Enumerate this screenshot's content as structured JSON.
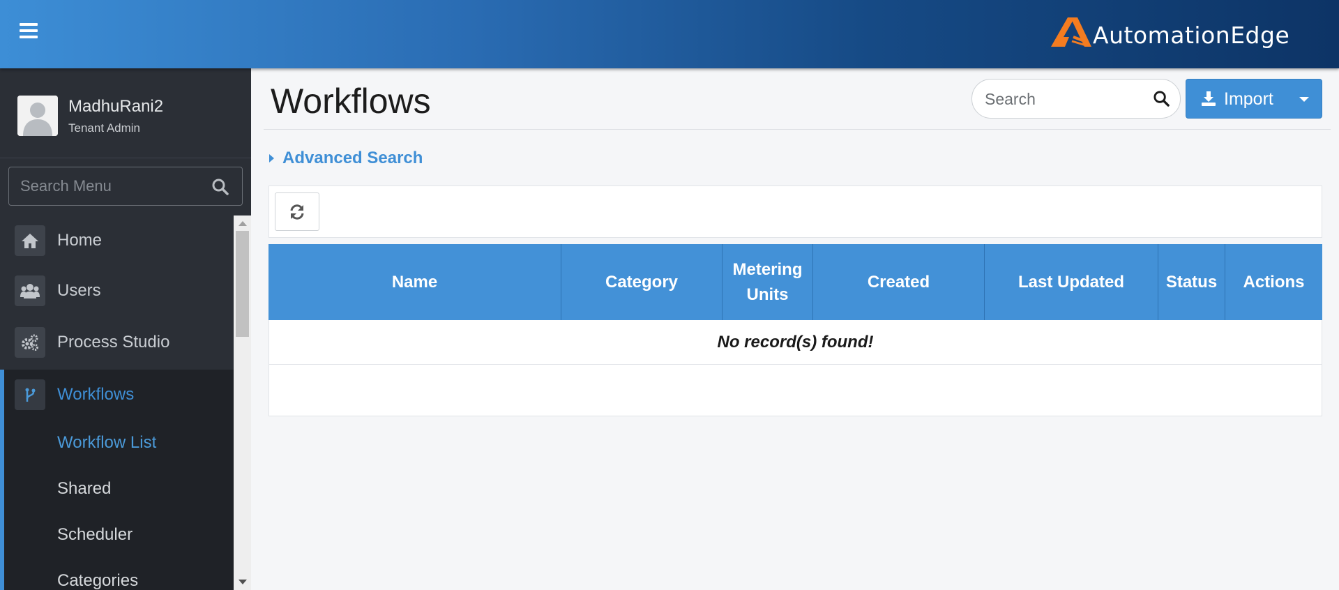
{
  "header": {
    "brand": "AutomationEdge",
    "brand_color": "#f47c20"
  },
  "user": {
    "name": "MadhuRani2",
    "role": "Tenant Admin"
  },
  "sidebar": {
    "search_placeholder": "Search Menu",
    "items": [
      {
        "label": "Home",
        "icon": "home-icon"
      },
      {
        "label": "Users",
        "icon": "users-icon"
      },
      {
        "label": "Process Studio",
        "icon": "gears-icon"
      },
      {
        "label": "Workflows",
        "icon": "workflow-icon",
        "active": true
      }
    ],
    "sub_items": [
      {
        "label": "Workflow List",
        "active": true
      },
      {
        "label": "Shared"
      },
      {
        "label": "Scheduler"
      },
      {
        "label": "Categories"
      }
    ]
  },
  "page": {
    "title": "Workflows",
    "search_placeholder": "Search",
    "import_label": "Import",
    "advanced_search_label": "Advanced Search"
  },
  "table": {
    "columns": [
      "Name",
      "Category",
      "Metering Units",
      "Created",
      "Last Updated",
      "Status",
      "Actions"
    ],
    "empty_message": "No record(s) found!"
  },
  "colors": {
    "accent": "#3f8fd6",
    "sidebar_bg": "#2b2f36",
    "header_gradient_start": "#3d8ed6",
    "header_gradient_end": "#0d3466"
  }
}
